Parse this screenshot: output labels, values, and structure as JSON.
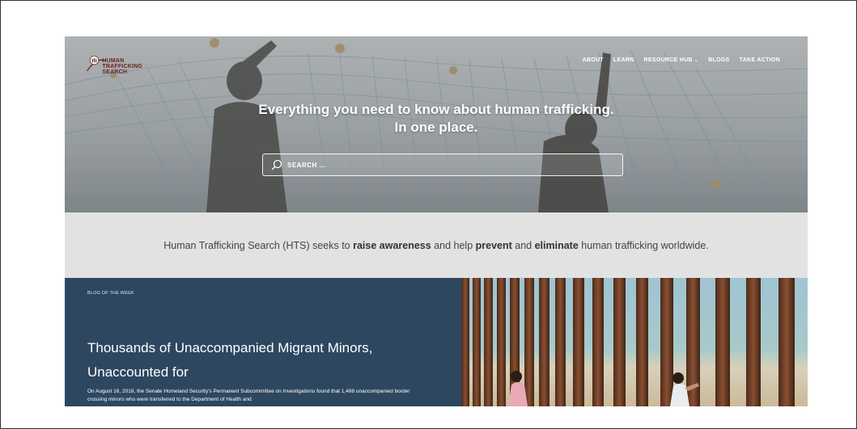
{
  "logo": {
    "alt_text": "HUMAN TRAFFICKING SEARCH"
  },
  "nav": {
    "items": [
      {
        "label": "ABOUT"
      },
      {
        "label": "LEARN"
      },
      {
        "label": "RESOURCE HUB"
      },
      {
        "label": "BLOGS"
      },
      {
        "label": "TAKE ACTION"
      }
    ],
    "dropdown_icon": "chevron-down-icon"
  },
  "hero": {
    "title_line1": "Everything you need to know about human trafficking.",
    "title_line2": "In one place.",
    "search_placeholder": "SEARCH ...",
    "search_icon": "search-icon"
  },
  "mission": {
    "part1": "Human Trafficking Search (HTS) seeks to ",
    "bold1": "raise awareness",
    "part2": " and help ",
    "bold2": "prevent",
    "part3": " and ",
    "bold3": "eliminate",
    "part4": " human trafficking worldwide."
  },
  "blog": {
    "kicker": "BLOG OF THE WEEK",
    "title": "Thousands of Unaccompanied Migrant Minors, Unaccounted for",
    "excerpt": "On August 16, 2018, the Senate Homeland Security's Permanent Subcommittee on Investigations found that 1,488 unaccompanied border crossing minors who were transferred to the Department of Health and"
  },
  "colors": {
    "blog_bg": "#2e4760",
    "mission_bg": "#e2e2e2",
    "logo_red": "#6b1e1e"
  }
}
